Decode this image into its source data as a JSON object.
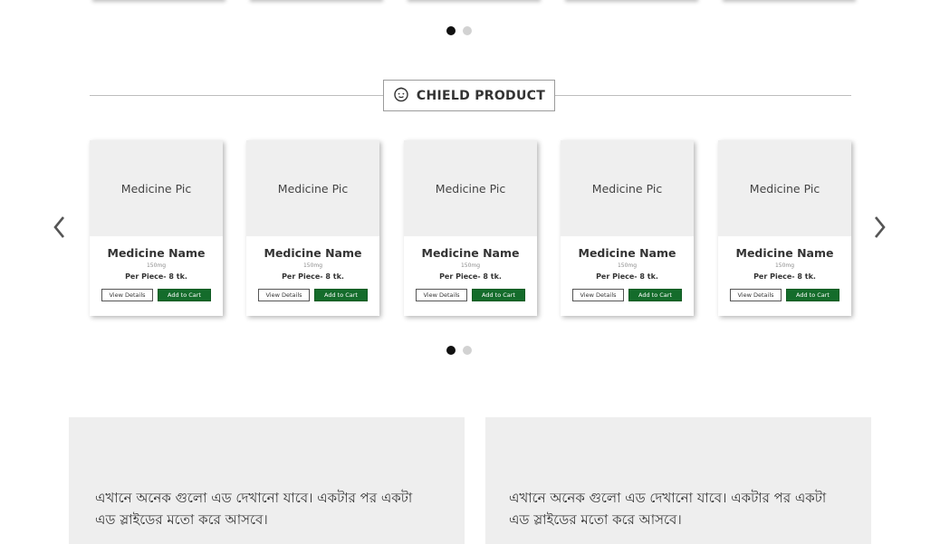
{
  "previous_carousel": {
    "dots": [
      true,
      false
    ]
  },
  "section": {
    "title": "CHIELD PRODUCT",
    "icon": "baby-face-icon"
  },
  "carousel": {
    "prev_icon": "chevron-left-icon",
    "next_icon": "chevron-right-icon",
    "dots": [
      true,
      false
    ],
    "products": [
      {
        "pic": "Medicine Pic",
        "name": "Medicine Name",
        "dose": "150mg",
        "price": "Per Piece- 8 tk.",
        "view_label": "View Details",
        "cart_label": "Add to Cart"
      },
      {
        "pic": "Medicine Pic",
        "name": "Medicine Name",
        "dose": "150mg",
        "price": "Per Piece- 8 tk.",
        "view_label": "View Details",
        "cart_label": "Add to Cart"
      },
      {
        "pic": "Medicine Pic",
        "name": "Medicine Name",
        "dose": "150mg",
        "price": "Per Piece- 8 tk.",
        "view_label": "View Details",
        "cart_label": "Add to Cart"
      },
      {
        "pic": "Medicine Pic",
        "name": "Medicine Name",
        "dose": "150mg",
        "price": "Per Piece- 8 tk.",
        "view_label": "View Details",
        "cart_label": "Add to Cart"
      },
      {
        "pic": "Medicine Pic",
        "name": "Medicine Name",
        "dose": "150mg",
        "price": "Per Piece- 8 tk.",
        "view_label": "View Details",
        "cart_label": "Add to Cart"
      }
    ]
  },
  "ads": [
    {
      "line1": "এখানে অনেক গুলো এড দেখানো যাবে। একটার পর একটা",
      "line2": "এড স্লাইডের মতো করে আসবে।"
    },
    {
      "line1": "এখানে অনেক গুলো এড দেখানো যাবে। একটার পর একটা",
      "line2": "এড স্লাইডের মতো করে আসবে।"
    }
  ],
  "colors": {
    "cart_button": "#146c2b",
    "picture_placeholder": "#efefef",
    "ad_panel": "#eeeeee"
  }
}
